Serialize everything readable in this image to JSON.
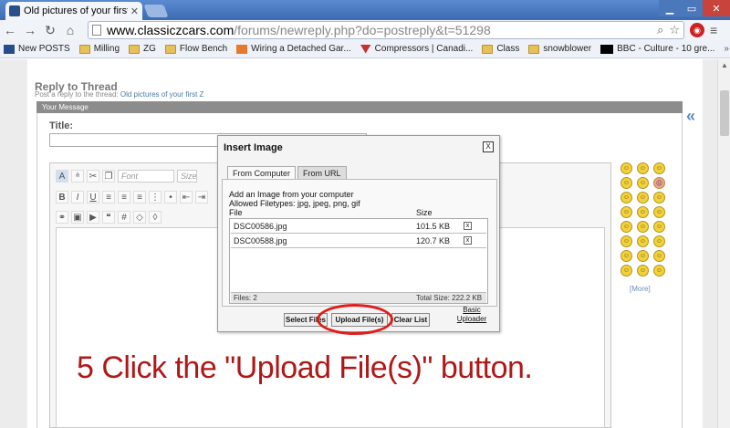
{
  "browser": {
    "tab_title": "Old pictures of your first Z - |",
    "url_host": "www.classiczcars.com",
    "url_rest": "/forums/newreply.php?do=postreply&t=51298",
    "bookmarks": [
      "New POSTS",
      "Milling",
      "ZG",
      "Flow Bench",
      "Wiring a Detached Gar...",
      "Compressors | Canadi...",
      "Class",
      "snowblower",
      "BBC - Culture - 10 gre..."
    ]
  },
  "page": {
    "heading": "Reply to Thread",
    "sub_prefix": "Post a reply to the thread:",
    "sub_link": "Old pictures of your first Z",
    "panel_header": "Your Message",
    "title_label": "Title:",
    "font_select": "Font",
    "size_select": "Size",
    "smilies_more": "[More]"
  },
  "dialog": {
    "title": "Insert Image",
    "close": "X",
    "tabs": [
      "From Computer",
      "From URL"
    ],
    "line1": "Add an Image from your computer",
    "line2": "Allowed Filetypes: jpg, jpeg, png, gif",
    "col_file": "File",
    "col_size": "Size",
    "files": [
      {
        "name": "DSC00586.jpg",
        "size": "101.5 KB"
      },
      {
        "name": "DSC00588.jpg",
        "size": "120.7 KB"
      }
    ],
    "files_count": "Files: 2",
    "total_size": "Total Size: 222.2 KB",
    "select_files": "Select Files",
    "upload_files": "Upload File(s)",
    "clear_list": "Clear List",
    "basic_uploader": "Basic Uploader"
  },
  "instruction": "5 Click the \"Upload File(s)\" button.",
  "colors": {
    "annotation": "#b01818",
    "highlight": "#e01d1d",
    "link": "#4b7aa8"
  }
}
